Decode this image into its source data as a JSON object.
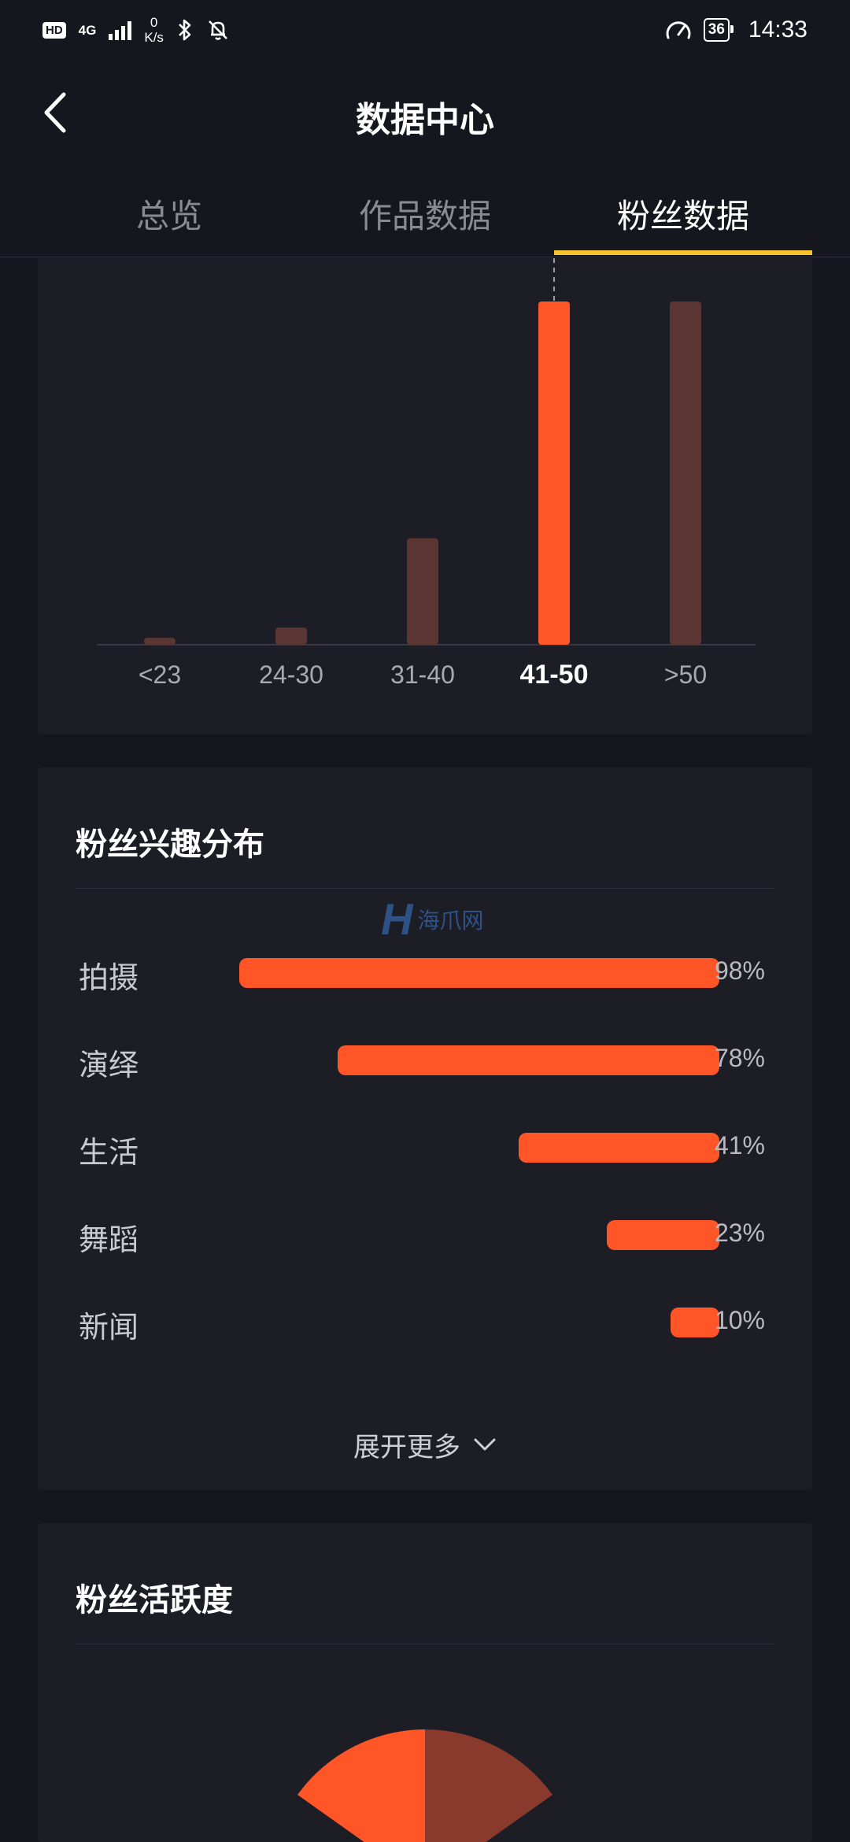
{
  "status_bar": {
    "hd_label": "HD",
    "network_label": "4G",
    "speed_value": "0",
    "speed_unit": "K/s",
    "battery_level": "36",
    "time": "14:33",
    "icons": [
      "signal-icon",
      "bluetooth-icon",
      "bell-off-icon",
      "speed-gauge-icon",
      "battery-icon"
    ]
  },
  "header": {
    "title": "数据中心",
    "back_icon": "chevron-left-icon"
  },
  "tabs": [
    {
      "label": "总览",
      "active": false
    },
    {
      "label": "作品数据",
      "active": false
    },
    {
      "label": "粉丝数据",
      "active": true
    }
  ],
  "colors": {
    "accent": "#ff5527",
    "accent_dim": "#5b3634",
    "tab_indicator": "#f5c42c",
    "background": "#16161e",
    "card": "#1d1d26"
  },
  "chart_data": {
    "type": "bar",
    "categories": [
      "<23",
      "24-30",
      "31-40",
      "41-50",
      ">50"
    ],
    "values": [
      2,
      5,
      31,
      100,
      100
    ],
    "highlighted_category": "41-50",
    "ylim": [
      0,
      100
    ],
    "grid": false
  },
  "interests": {
    "title": "粉丝兴趣分布",
    "items": [
      {
        "label": "拍摄",
        "value": "98%",
        "pct": 98
      },
      {
        "label": "演绎",
        "value": "78%",
        "pct": 78
      },
      {
        "label": "生活",
        "value": "41%",
        "pct": 41
      },
      {
        "label": "舞蹈",
        "value": "23%",
        "pct": 23
      },
      {
        "label": "新闻",
        "value": "10%",
        "pct": 10
      }
    ],
    "expand_label": "展开更多",
    "expand_icon": "chevron-down-icon"
  },
  "activity": {
    "title": "粉丝活跃度"
  },
  "watermark": {
    "logo": "H",
    "text": "海爪网"
  }
}
